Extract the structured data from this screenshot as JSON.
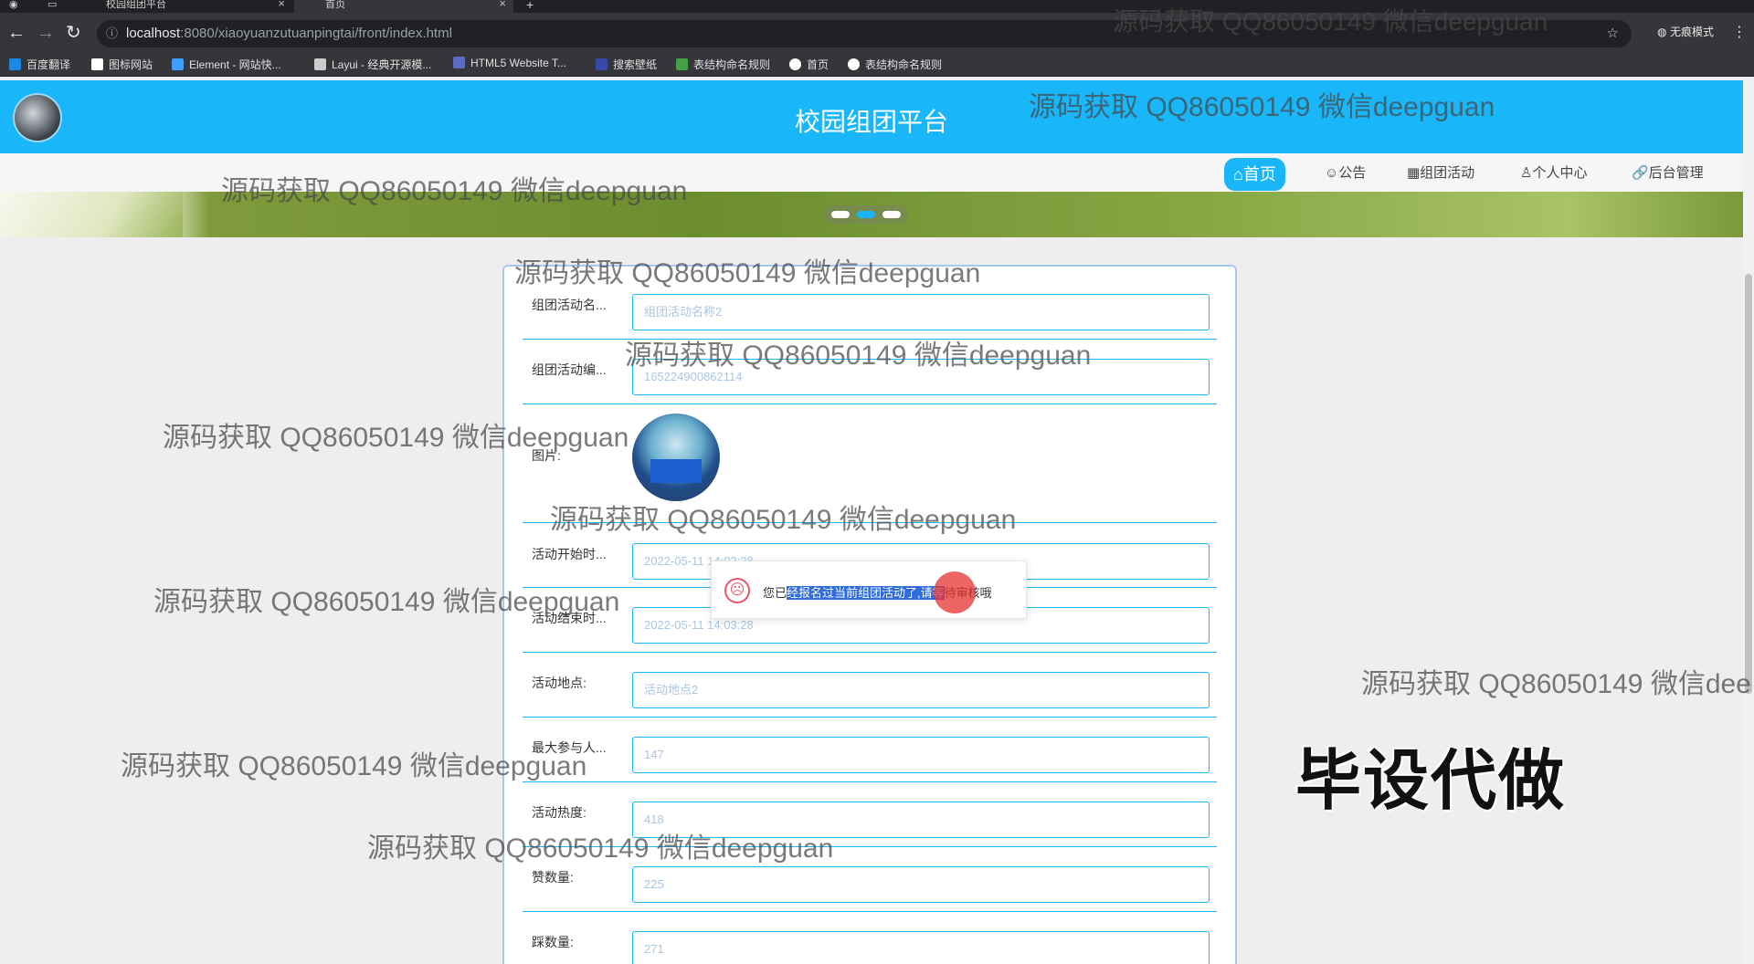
{
  "browser": {
    "tabs": [
      {
        "title": "校园组团平台",
        "active": false
      },
      {
        "title": "首页",
        "active": true
      }
    ],
    "url_host": "localhost",
    "url_path": ":8080/xiaoyuanzutuanpingtai/front/index.html",
    "incognito_label": "无痕模式",
    "bookmarks": [
      {
        "label": "百度翻译",
        "color": "#1e88e5"
      },
      {
        "label": "图标网站",
        "color": "#ffffff"
      },
      {
        "label": "Element - 网站快...",
        "color": "#409eff"
      },
      {
        "label": "Layui - 经典开源模...",
        "color": "#cccccc"
      },
      {
        "label": "HTML5 Website T...",
        "color": "#5c6bc0"
      },
      {
        "label": "搜索壁纸",
        "color": "#3949ab"
      },
      {
        "label": "表结构命名规则",
        "color": "#43a047"
      },
      {
        "label": "首页",
        "color": "#ffffff"
      },
      {
        "label": "表结构命名规则",
        "color": "#ffffff"
      }
    ]
  },
  "site": {
    "title": "校园组团平台",
    "accent": "#19b6fa",
    "nav": [
      {
        "label": "⌂首页",
        "active": true
      },
      {
        "label": "☺公告",
        "active": false
      },
      {
        "label": "▦组团活动",
        "active": false
      },
      {
        "label": "♙个人中心",
        "active": false
      },
      {
        "label": "🔗后台管理",
        "active": false
      }
    ]
  },
  "form": {
    "fields": [
      {
        "label": "组团活动名...",
        "value": "组团活动名称2"
      },
      {
        "label": "组团活动编...",
        "value": "165224900862114"
      },
      {
        "label": "图片:",
        "value": ""
      },
      {
        "label": "活动开始时...",
        "value": "2022-05-11 14:03:28"
      },
      {
        "label": "活动结束时...",
        "value": "2022-05-11 14:03:28"
      },
      {
        "label": "活动地点:",
        "value": "活动地点2"
      },
      {
        "label": "最大参与人...",
        "value": "147"
      },
      {
        "label": "活动热度:",
        "value": "418"
      },
      {
        "label": "赞数量:",
        "value": "225"
      },
      {
        "label": "踩数量:",
        "value": "271"
      }
    ]
  },
  "toast": {
    "prefix": "您已",
    "selected": "经报名过当前组团活动了,请等",
    "suffix": "待审核哦"
  },
  "watermarks": [
    "源码获取 QQ86050149 微信deepguan",
    "源码获取 QQ86050149 微信deepguan",
    "源码获取 QQ86050149 微信deepguan",
    "源码获取 QQ86050149 微信deepguan",
    "源码获取 QQ86050149 微信deepguan",
    "源码获取 QQ86050149 微信deepguan",
    "源码获取 QQ86050149 微信deepguan",
    "源码获取 QQ86050149 微信deepguan",
    "源码获取 QQ86050149 微信deepguan",
    "源码获取 QQ86050149 微信dee",
    "源码获取 QQ86050149 微信deepguan"
  ],
  "stamp": "毕设代做"
}
